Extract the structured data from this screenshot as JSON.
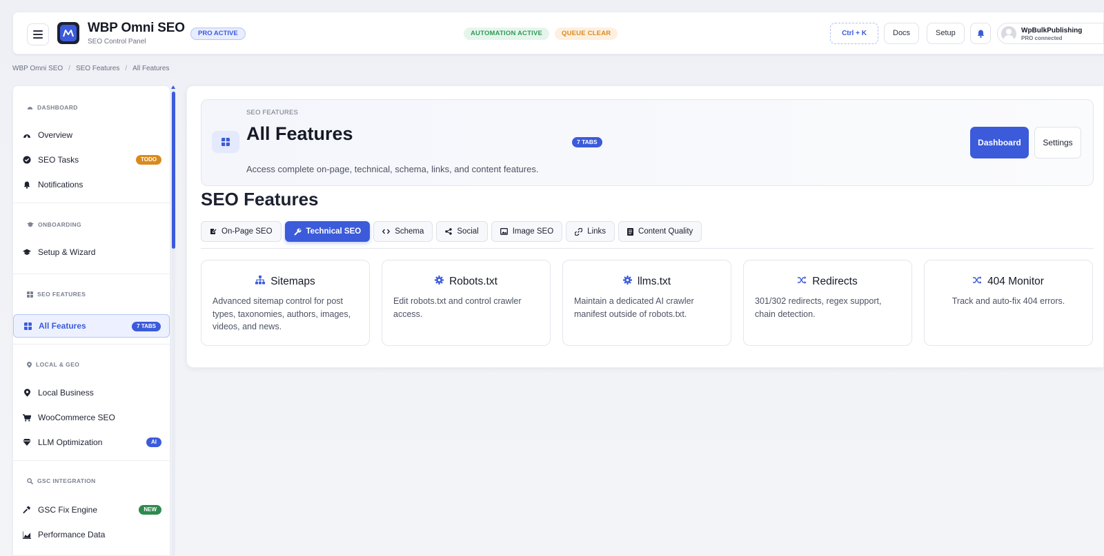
{
  "header": {
    "app_title": "WBP Omni SEO",
    "app_subtitle": "SEO Control Panel",
    "pro_badge": "PRO ACTIVE",
    "status_automation": "AUTOMATION ACTIVE",
    "status_queue": "QUEUE CLEAR",
    "shortcut": "Ctrl + K",
    "docs": "Docs",
    "setup": "Setup",
    "user_name": "WpBulkPublishing",
    "user_status": "PRO connected"
  },
  "breadcrumb": [
    "WBP Omni SEO",
    "SEO Features",
    "All Features"
  ],
  "sidebar": {
    "sections": {
      "dashboard": "DASHBOARD",
      "onboarding": "ONBOARDING",
      "seo_features": "SEO FEATURES",
      "local_geo": "LOCAL & GEO",
      "gsc": "GSC INTEGRATION"
    },
    "items": {
      "overview": "Overview",
      "seo_tasks": "SEO Tasks",
      "seo_tasks_badge": "TODO",
      "notifications": "Notifications",
      "setup_wizard": "Setup & Wizard",
      "all_features": "All Features",
      "all_features_badge": "7 TABS",
      "local_business": "Local Business",
      "woocommerce": "WooCommerce SEO",
      "llm": "LLM Optimization",
      "llm_badge": "AI",
      "gsc_fix": "GSC Fix Engine",
      "gsc_fix_badge": "NEW",
      "performance": "Performance Data"
    }
  },
  "hero": {
    "kicker": "SEO FEATURES",
    "title": "All Features",
    "tabs_badge": "7 TABS",
    "description": "Access complete on-page, technical, schema, links, and content features.",
    "dashboard_btn": "Dashboard",
    "settings_btn": "Settings"
  },
  "section_title": "SEO Features",
  "tabs": [
    "On-Page SEO",
    "Technical SEO",
    "Schema",
    "Social",
    "Image SEO",
    "Links",
    "Content Quality"
  ],
  "active_tab": "Technical SEO",
  "cards": [
    {
      "title": "Sitemaps",
      "icon": "sitemap-icon",
      "desc": "Advanced sitemap control for post types, taxonomies, authors, images, videos, and news."
    },
    {
      "title": "Robots.txt",
      "icon": "gear-icon",
      "desc": "Edit robots.txt and control crawler access."
    },
    {
      "title": "llms.txt",
      "icon": "gear-icon",
      "desc": "Maintain a dedicated AI crawler manifest outside of robots.txt."
    },
    {
      "title": "Redirects",
      "icon": "shuffle-icon",
      "desc": "301/302 redirects, regex support, chain detection."
    },
    {
      "title": "404 Monitor",
      "icon": "shuffle-icon",
      "desc": "Track and auto-fix 404 errors."
    }
  ],
  "colors": {
    "accent": "#3b5bdb",
    "todo": "#d98a1f",
    "new": "#2f8a4e",
    "automation": "#2f9a56",
    "queue": "#d98a1f"
  }
}
